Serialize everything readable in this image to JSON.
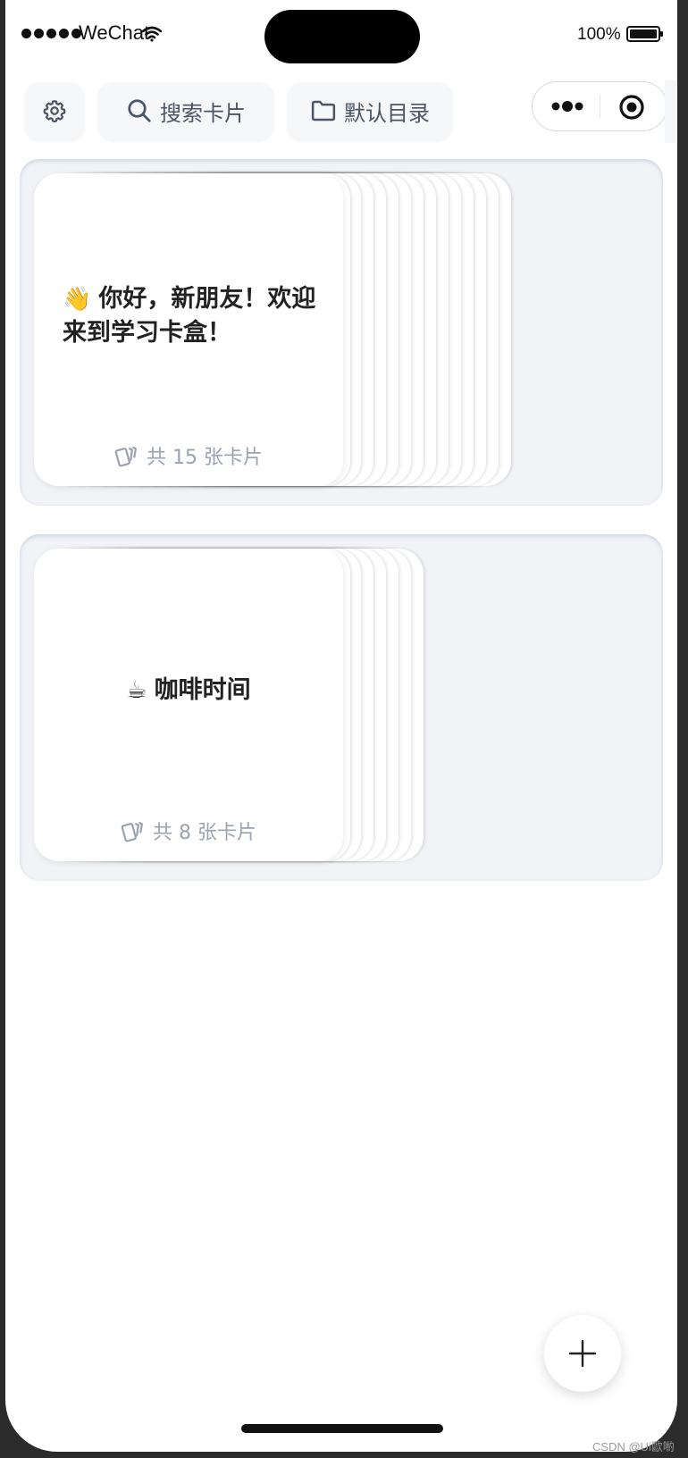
{
  "status_bar": {
    "carrier": "WeChat",
    "battery_percent": "100%"
  },
  "toolbar": {
    "settings_icon": "gear-icon",
    "search_label": "搜索卡片",
    "search_icon": "search-icon",
    "folder_label": "默认目录",
    "folder_icon": "folder-icon"
  },
  "capsule": {
    "more_icon": "more-dots-icon",
    "close_icon": "target-close-icon"
  },
  "decks": [
    {
      "emoji": "👋",
      "title": "你好，新朋友！欢迎来到学习卡盒！",
      "count_label": "共 15 张卡片",
      "card_count": 15
    },
    {
      "emoji": "☕",
      "title": "咖啡时间",
      "count_label": "共 8 张卡片",
      "card_count": 8
    }
  ],
  "fab": {
    "icon": "plus-icon"
  },
  "watermark": "CSDN @Ui歐喲",
  "colors": {
    "deck_bg": "#f1f3f6",
    "muted_text": "#9aa3b0",
    "title_text": "#222222"
  }
}
